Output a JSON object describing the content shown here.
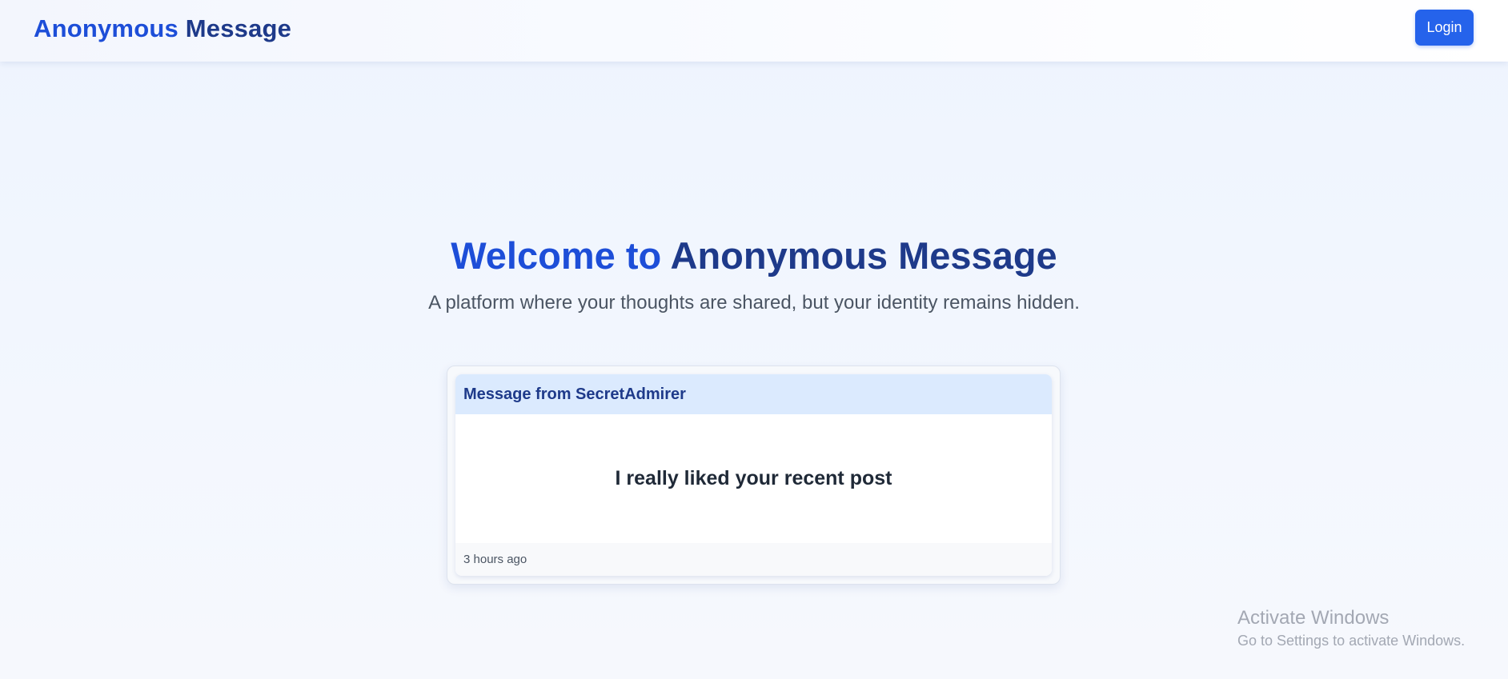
{
  "header": {
    "brand_part_a": "Anonymous",
    "brand_part_b": "Message",
    "login_label": "Login"
  },
  "hero": {
    "title_part_a": "Welcome to",
    "title_part_b": "Anonymous Message",
    "subtitle": "A platform where your thoughts are shared, but your identity remains hidden."
  },
  "message_card": {
    "header": "Message from SecretAdmirer",
    "body": "I really liked your recent post",
    "timestamp": "3 hours ago"
  },
  "watermark": {
    "title": "Activate Windows",
    "subtitle": "Go to Settings to activate Windows."
  },
  "colors": {
    "accent": "#2563eb",
    "brand_light": "#1d4ed8",
    "brand_dark": "#1e3a8a",
    "card_header_bg": "#dbeafe"
  }
}
